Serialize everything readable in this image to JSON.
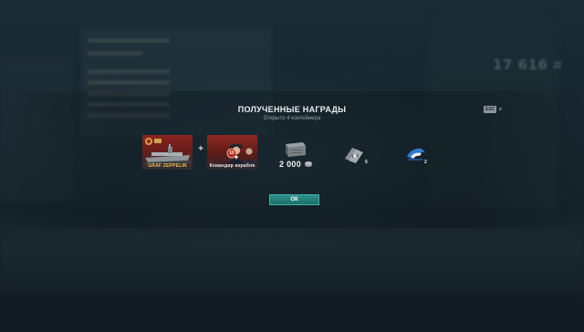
{
  "background": {
    "credits_display": "17 616 ¤"
  },
  "dialog": {
    "title": "ПОЛУЧЕННЫЕ НАГРАДЫ",
    "subtitle": "Открыто 4 контейнера",
    "esc_key": "ESC",
    "close_symbol": "×",
    "ok_label": "ОК"
  },
  "rewards": {
    "ship": {
      "name": "GRAF ZEPPELIN",
      "tier": "VIII",
      "icon": "aircraft-carrier-icon"
    },
    "plus": "+",
    "commander": {
      "label": "Командир корабля",
      "skill_points": "10",
      "icon": "commander-portrait-icon"
    },
    "credits": {
      "amount": "2 000",
      "icon": "credits-icon"
    },
    "signals": {
      "count": "5",
      "icon": "signal-flag-icon"
    },
    "camouflage": {
      "count": "2",
      "icon": "camouflage-icon"
    }
  },
  "colors": {
    "accent_button": "#2c8f8a",
    "ship_name": "#e8c25a",
    "card_red": "#8a2520"
  }
}
